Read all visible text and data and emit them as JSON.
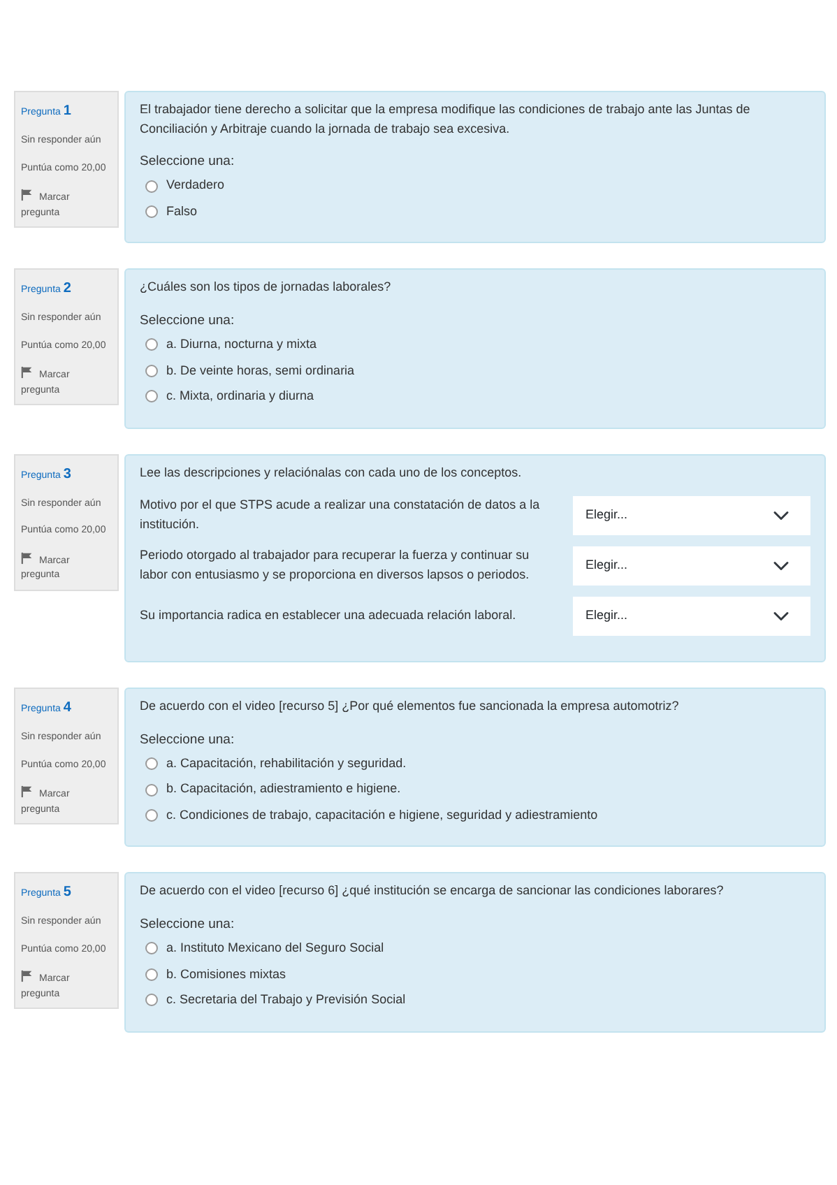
{
  "questions": [
    {
      "kind": "choice",
      "label": "Pregunta",
      "number": "1",
      "status": "Sin responder aún",
      "score": "Puntúa como 20,00",
      "flag": "Marcar pregunta",
      "text": "El trabajador tiene derecho a solicitar que la empresa modifique las condiciones de trabajo ante las Juntas de Conciliación y Arbitraje cuando la jornada de trabajo sea excesiva.",
      "prompt": "Seleccione una:",
      "options": [
        {
          "label": "Verdadero",
          "selected": false
        },
        {
          "label": "Falso",
          "selected": false
        }
      ]
    },
    {
      "kind": "choice",
      "label": "Pregunta",
      "number": "2",
      "status": "Sin responder aún",
      "score": "Puntúa como 20,00",
      "flag": "Marcar pregunta",
      "text": "¿Cuáles son los tipos de jornadas laborales?",
      "prompt": "Seleccione una:",
      "options": [
        {
          "label": "a. Diurna, nocturna y mixta",
          "selected": false
        },
        {
          "label": "b. De veinte horas, semi ordinaria",
          "selected": false
        },
        {
          "label": "c. Mixta, ordinaria y diurna",
          "selected": false
        }
      ]
    },
    {
      "kind": "match",
      "label": "Pregunta",
      "number": "3",
      "status": "Sin responder aún",
      "score": "Puntúa como 20,00",
      "flag": "Marcar pregunta",
      "text": "Lee las descripciones y relaciónalas con cada uno de los conceptos.",
      "pairs": [
        {
          "label": "Motivo por el que STPS acude a realizar una constatación de datos a la institución.",
          "value": "Elegir..."
        },
        {
          "label": "Periodo otorgado al trabajador para recuperar la fuerza y continuar su labor con entusiasmo y se proporciona en diversos lapsos o periodos.",
          "value": "Elegir..."
        },
        {
          "label": "Su importancia radica en establecer una adecuada relación laboral.",
          "value": "Elegir..."
        }
      ]
    },
    {
      "kind": "choice",
      "label": "Pregunta",
      "number": "4",
      "status": "Sin responder aún",
      "score": "Puntúa como 20,00",
      "flag": "Marcar pregunta",
      "text": "De acuerdo con el video [recurso 5] ¿Por qué elementos fue sancionada la empresa automotriz?",
      "prompt": "Seleccione una:",
      "options": [
        {
          "label": "a. Capacitación, rehabilitación y seguridad.",
          "selected": false
        },
        {
          "label": "b. Capacitación, adiestramiento e higiene.",
          "selected": false
        },
        {
          "label": "c. Condiciones de trabajo, capacitación e higiene, seguridad y adiestramiento",
          "selected": false
        }
      ]
    },
    {
      "kind": "choice",
      "label": "Pregunta",
      "number": "5",
      "status": "Sin responder aún",
      "score": "Puntúa como 20,00",
      "flag": "Marcar pregunta",
      "text": "De acuerdo con el  video [recurso 6] ¿qué institución se encarga de sancionar las condiciones laborares?",
      "prompt": "Seleccione una:",
      "options": [
        {
          "label": "a. Instituto Mexicano del Seguro Social",
          "selected": false
        },
        {
          "label": "b. Comisiones mixtas",
          "selected": false
        },
        {
          "label": "c. Secretaria del Trabajo y Previsión Social",
          "selected": false
        }
      ]
    }
  ]
}
